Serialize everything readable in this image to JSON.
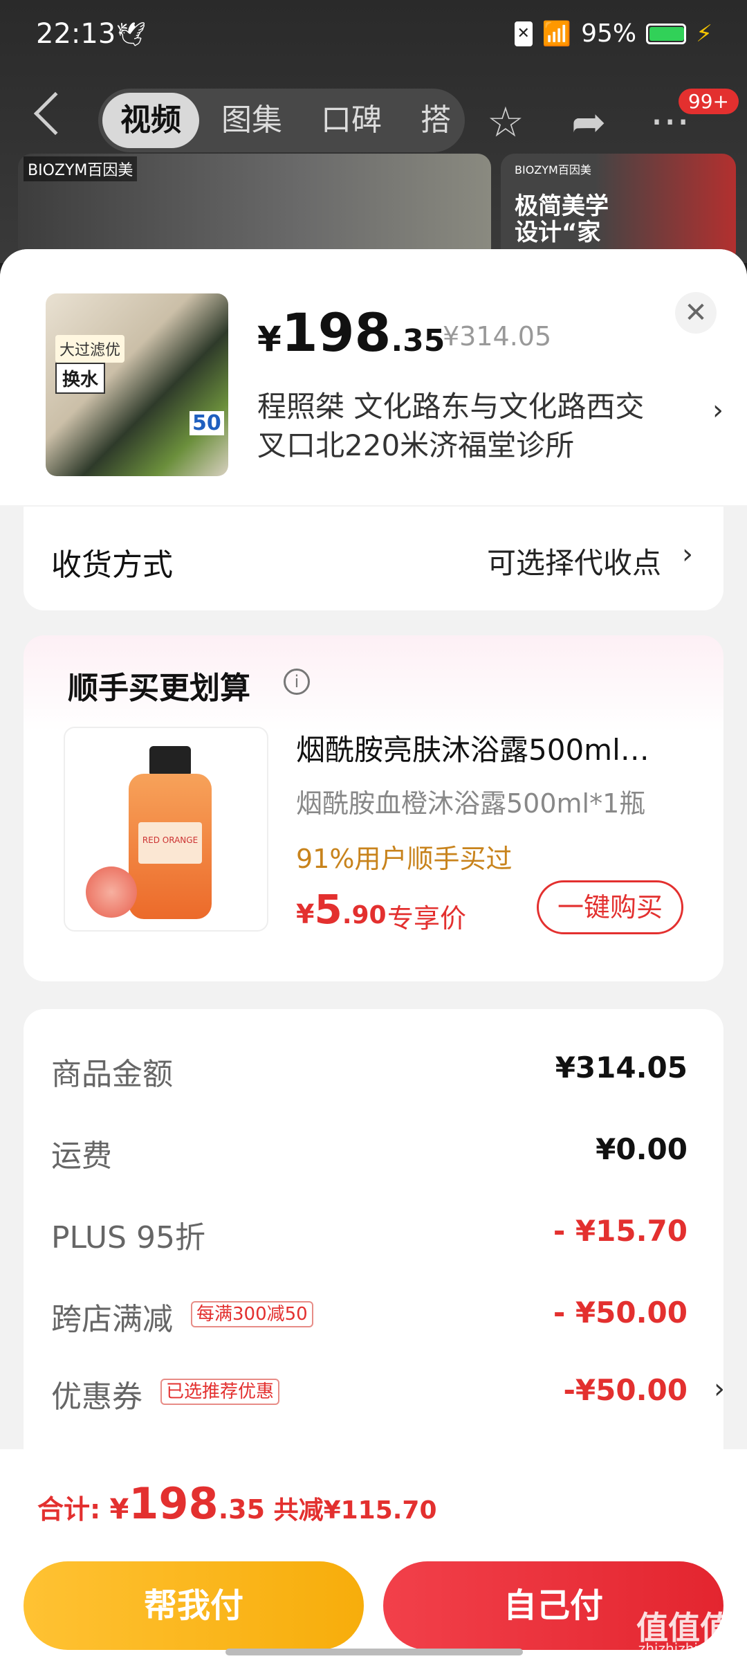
{
  "status": {
    "time": "22:13",
    "battery": "95%",
    "battery_level": 0.95
  },
  "nav": {
    "tabs": [
      "视频",
      "图集",
      "口碑",
      "搭配"
    ],
    "badge": "99+"
  },
  "background": {
    "left_brand": "BIOZYM百因美",
    "right_brand": "BIOZYM百因美",
    "right_line1": "极简美学",
    "right_line2": "设计“家"
  },
  "product": {
    "thumb_tag": "大过滤优",
    "thumb_label": "换水",
    "thumb_badge": "50",
    "price_yen": "¥",
    "price_int": "198",
    "price_dec": ".35",
    "original_price": "¥314.05",
    "address": "程照桀  文化路东与文化路西交叉口北220米济福堂诊所"
  },
  "shipping": {
    "label": "收货方式",
    "value": "可选择代收点"
  },
  "upsell": {
    "title": "顺手买更划算",
    "name": "烟酰胺亮肤沐浴露500ml…",
    "spec": "烟酰胺血橙沐浴露500ml*1瓶",
    "hint": "91%用户顺手买过",
    "price_yen": "¥",
    "price_int": "5",
    "price_dec": ".90",
    "price_tag": "专享价",
    "buy_label": "一键购买",
    "bottle_label": "RED ORANGE"
  },
  "price_rows": [
    {
      "label": "商品金额",
      "value": "¥314.05",
      "tag": ""
    },
    {
      "label": "运费",
      "value": "¥0.00",
      "tag": ""
    },
    {
      "label": "PLUS 95折",
      "value": "- ¥15.70",
      "tag": ""
    },
    {
      "label": "跨店满减",
      "value": "- ¥50.00",
      "tag": "每满300减50"
    },
    {
      "label": "优惠券",
      "value": "-¥50.00",
      "tag": "已选推荐优惠"
    }
  ],
  "footer": {
    "total_label": "合计: ",
    "total_yen": "¥",
    "total_int": "198",
    "total_dec": ".35",
    "saved": " 共减¥115.70",
    "help_pay": "帮我付",
    "self_pay": "自己付"
  },
  "watermark": {
    "main": "值值值",
    "sub": "zhizhizhi.com"
  },
  "colors": {
    "accent_red": "#e3302f",
    "hint_orange": "#c8831c",
    "help_yellow": "#ffc233"
  }
}
